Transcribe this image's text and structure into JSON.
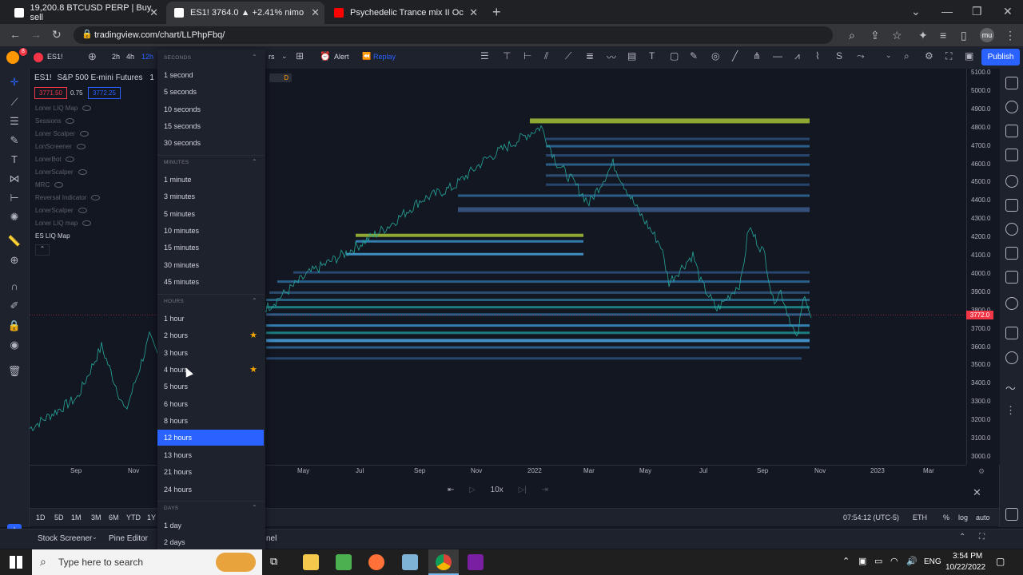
{
  "browser": {
    "tabs": [
      {
        "title": "19,200.8 BTCUSD PERP | Buy, sell"
      },
      {
        "title": "ES1! 3764.0 ▲ +2.41% nimo"
      },
      {
        "title": "Psychedelic Trance mix II Oc"
      }
    ],
    "url": "tradingview.com/chart/LLPhpFbq/",
    "profile": "mu"
  },
  "toolbar": {
    "symbol": "ES1!",
    "badge": "8",
    "tf_2h": "2h",
    "tf_4h": "4h",
    "tf_12h": "12h",
    "indicators_partial": "rs",
    "alert": "Alert",
    "replay": "Replay",
    "publish": "Publish"
  },
  "chart_header": {
    "symbol": "ES1!",
    "name": "S&P 500 E-mini Futures",
    "interval_partial": "1",
    "bid": "3771.50",
    "spread": "0.75",
    "ask": "3772.25",
    "d_badge": "D"
  },
  "legend_items": [
    "Loner LIQ Map",
    "Sessions",
    "Loner Scalper",
    "LonScreener",
    "LonerBot",
    "LonerScalper",
    "MRC",
    "Reversal Indicator",
    "LonerScalper",
    "Loner LIQ map"
  ],
  "legend_active": "ES LIQ Map",
  "price_axis": [
    "5100.0",
    "5000.0",
    "4900.0",
    "4800.0",
    "4700.0",
    "4600.0",
    "4500.0",
    "4400.0",
    "4300.0",
    "4200.0",
    "4100.0",
    "4000.0",
    "3900.0",
    "3800.0",
    "3700.0",
    "3600.0",
    "3500.0",
    "3400.0",
    "3300.0",
    "3200.0",
    "3100.0",
    "3000.0"
  ],
  "current_price": "3772.0",
  "time_axis": [
    "Sep",
    "Nov",
    "May",
    "Jul",
    "Sep",
    "Nov",
    "2022",
    "Mar",
    "May",
    "Jul",
    "Sep",
    "Nov",
    "2023",
    "Mar"
  ],
  "replay_speed": "10x",
  "bottom": {
    "ranges": [
      "1D",
      "5D",
      "1M",
      "3M",
      "6M",
      "YTD",
      "1Y"
    ],
    "clock": "07:54:12 (UTC-5)",
    "session": "ETH",
    "percent": "%",
    "log": "log",
    "auto": "auto"
  },
  "panel_tabs": {
    "stock_screener": "Stock Screener",
    "pine_editor": "Pine Editor",
    "partial": "nel"
  },
  "dropdown": {
    "sections": [
      {
        "header": "SECONDS",
        "items": [
          "1 second",
          "5 seconds",
          "10 seconds",
          "15 seconds",
          "30 seconds"
        ]
      },
      {
        "header": "MINUTES",
        "items": [
          "1 minute",
          "3 minutes",
          "5 minutes",
          "10 minutes",
          "15 minutes",
          "30 minutes",
          "45 minutes"
        ]
      },
      {
        "header": "HOURS",
        "items": [
          "1 hour",
          "2 hours",
          "3 hours",
          "4 hours",
          "5 hours",
          "6 hours",
          "8 hours",
          "12 hours",
          "13 hours",
          "21 hours",
          "24 hours"
        ]
      },
      {
        "header": "DAYS",
        "items": [
          "1 day",
          "2 days"
        ]
      }
    ],
    "selected": "12 hours",
    "favorites": [
      "2 hours",
      "4 hours"
    ]
  },
  "taskbar": {
    "search_placeholder": "Type here to search",
    "lang": "ENG",
    "time": "3:54 PM",
    "date": "10/22/2022"
  },
  "colors": {
    "accent": "#2962ff",
    "liq_yellow": "#a5c336",
    "liq_blue": "#4aa3df",
    "price_red": "#f23645"
  }
}
